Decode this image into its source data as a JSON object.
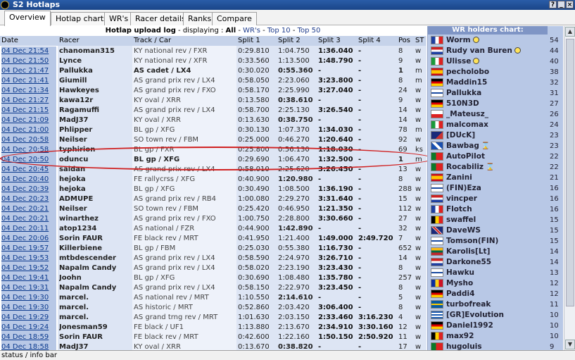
{
  "window": {
    "title": "S2 Hotlaps",
    "buttons": [
      "?",
      "_",
      "×"
    ]
  },
  "tabs": [
    {
      "label": "Overview",
      "active": true
    },
    {
      "label": "Hotlap charts",
      "active": false
    },
    {
      "label": "WR's",
      "active": false
    },
    {
      "label": "Racer details",
      "active": false
    },
    {
      "label": "Ranks",
      "active": false
    },
    {
      "label": "Compare",
      "active": false
    }
  ],
  "log": {
    "heading": "Hotlap upload log",
    "displaying_label": " - displaying : ",
    "filter_all": "All",
    "filter_sep": " - ",
    "filter_wrs": "WR's",
    "filter_top10": "Top 10",
    "filter_top50": "Top 50",
    "columns": [
      "Date",
      "Racer",
      "Track / Car",
      "Split 1",
      "Split 2",
      "Split 3",
      "Split 4",
      "Pos",
      "ST"
    ],
    "rows": [
      {
        "date": "04 Dec 21:54",
        "racer": "chanoman315",
        "track": "KY national rev / FXR",
        "s1": "0:29.810",
        "s2": "1:04.750",
        "s3": "1:36.040",
        "s4": "-",
        "pos": "8",
        "st": "w"
      },
      {
        "date": "04 Dec 21:50",
        "racer": "Lynce",
        "track": "KY national rev / XFR",
        "s1": "0:33.560",
        "s2": "1:13.500",
        "s3": "1:48.790",
        "s4": "-",
        "pos": "9",
        "st": "w"
      },
      {
        "date": "04 Dec 21:47",
        "racer": "Pallukka",
        "track": "AS cadet / LX4",
        "s1": "0:30.020",
        "s2": "0:55.360",
        "s3": "-",
        "s4": "-",
        "pos": "1",
        "st": "m"
      },
      {
        "date": "04 Dec 21:41",
        "racer": "Giumill",
        "track": "AS grand prix rev / LX4",
        "s1": "0:58.050",
        "s2": "2:23.060",
        "s3": "3:23.800",
        "s4": "-",
        "pos": "8",
        "st": "m"
      },
      {
        "date": "04 Dec 21:34",
        "racer": "Hawkeyes",
        "track": "AS grand prix rev / FXO",
        "s1": "0:58.170",
        "s2": "2:25.990",
        "s3": "3:27.040",
        "s4": "-",
        "pos": "24",
        "st": "w"
      },
      {
        "date": "04 Dec 21:27",
        "racer": "kawa12r",
        "track": "KY oval / XRR",
        "s1": "0:13.580",
        "s2": "0:38.610",
        "s3": "-",
        "s4": "-",
        "pos": "9",
        "st": "w"
      },
      {
        "date": "04 Dec 21:15",
        "racer": "Ragamuffi",
        "track": "AS grand prix rev / LX4",
        "s1": "0:58.700",
        "s2": "2:25.130",
        "s3": "3:26.540",
        "s4": "-",
        "pos": "14",
        "st": "w"
      },
      {
        "date": "04 Dec 21:09",
        "racer": "MadJ37",
        "track": "KY oval / XRR",
        "s1": "0:13.630",
        "s2": "0:38.750",
        "s3": "-",
        "s4": "-",
        "pos": "14",
        "st": "w"
      },
      {
        "date": "04 Dec 21:00",
        "racer": "Phlipper",
        "track": "BL gp / XFG",
        "s1": "0:30.130",
        "s2": "1:07.370",
        "s3": "1:34.030",
        "s4": "-",
        "pos": "78",
        "st": "m"
      },
      {
        "date": "04 Dec 20:58",
        "racer": "Neilser",
        "track": "SO town rev / FBM",
        "s1": "0:25.000",
        "s2": "0:46.270",
        "s3": "1:20.640",
        "s4": "-",
        "pos": "92",
        "st": "w"
      },
      {
        "date": "04 Dec 20:58",
        "racer": "typhirion",
        "track": "BL gp / FXR",
        "s1": "0:25.800",
        "s2": "0:56.130",
        "s3": "1:18.030",
        "s4": "-",
        "pos": "69",
        "st": "ks"
      },
      {
        "date": "04 Dec 20:50",
        "racer": "oduncu",
        "track": "BL gp / XFG",
        "s1": "0:29.690",
        "s2": "1:06.470",
        "s3": "1:32.500",
        "s4": "-",
        "pos": "1",
        "st": "m",
        "highlight": true
      },
      {
        "date": "04 Dec 20:45",
        "racer": "saldan",
        "track": "AS grand prix rev / LX4",
        "s1": "0:58.010",
        "s2": "2:25.620",
        "s3": "3:26.450",
        "s4": "-",
        "pos": "13",
        "st": "w"
      },
      {
        "date": "04 Dec 20:40",
        "racer": "hejoka",
        "track": "FE rallycrss / XFG",
        "s1": "0:40.900",
        "s2": "1:20.980",
        "s3": "-",
        "s4": "-",
        "pos": "8",
        "st": "w"
      },
      {
        "date": "04 Dec 20:39",
        "racer": "hejoka",
        "track": "BL gp / XFG",
        "s1": "0:30.490",
        "s2": "1:08.500",
        "s3": "1:36.190",
        "s4": "-",
        "pos": "288",
        "st": "w"
      },
      {
        "date": "04 Dec 20:23",
        "racer": "ADMUPE",
        "track": "AS grand prix rev / RB4",
        "s1": "1:00.080",
        "s2": "2:29.270",
        "s3": "3:31.640",
        "s4": "-",
        "pos": "15",
        "st": "w"
      },
      {
        "date": "04 Dec 20:21",
        "racer": "Neilser",
        "track": "SO town rev / FBM",
        "s1": "0:25.420",
        "s2": "0:46.950",
        "s3": "1:21.350",
        "s4": "-",
        "pos": "112",
        "st": "w"
      },
      {
        "date": "04 Dec 20:21",
        "racer": "winarthez",
        "track": "AS grand prix rev / FXO",
        "s1": "1:00.750",
        "s2": "2:28.800",
        "s3": "3:30.660",
        "s4": "-",
        "pos": "27",
        "st": "w"
      },
      {
        "date": "04 Dec 20:11",
        "racer": "atop1234",
        "track": "AS national / FZR",
        "s1": "0:44.900",
        "s2": "1:42.890",
        "s3": "-",
        "s4": "-",
        "pos": "32",
        "st": "w"
      },
      {
        "date": "04 Dec 20:06",
        "racer": "Sorin FAUR",
        "track": "FE black rev / MRT",
        "s1": "0:41.950",
        "s2": "1:21.400",
        "s3": "1:49.000",
        "s4": "2:49.720",
        "pos": "7",
        "st": "w"
      },
      {
        "date": "04 Dec 19:57",
        "racer": "Killerbiene",
        "track": "BL gp / FBM",
        "s1": "0:25.030",
        "s2": "0:55.380",
        "s3": "1:16.730",
        "s4": "-",
        "pos": "652",
        "st": "w"
      },
      {
        "date": "04 Dec 19:53",
        "racer": "mtbdescender",
        "track": "AS grand prix rev / LX4",
        "s1": "0:58.590",
        "s2": "2:24.970",
        "s3": "3:26.710",
        "s4": "-",
        "pos": "14",
        "st": "w"
      },
      {
        "date": "04 Dec 19:52",
        "racer": "Napalm Candy",
        "track": "AS grand prix rev / LX4",
        "s1": "0:58.020",
        "s2": "2:23.190",
        "s3": "3:23.430",
        "s4": "-",
        "pos": "8",
        "st": "w"
      },
      {
        "date": "04 Dec 19:41",
        "racer": "Joohn",
        "track": "BL gp / XFG",
        "s1": "0:30.690",
        "s2": "1:08.480",
        "s3": "1:35.780",
        "s4": "-",
        "pos": "257",
        "st": "w"
      },
      {
        "date": "04 Dec 19:31",
        "racer": "Napalm Candy",
        "track": "AS grand prix rev / LX4",
        "s1": "0:58.150",
        "s2": "2:22.970",
        "s3": "3:23.450",
        "s4": "-",
        "pos": "8",
        "st": "w"
      },
      {
        "date": "04 Dec 19:30",
        "racer": "marcel.",
        "track": "AS national rev / MRT",
        "s1": "1:10.550",
        "s2": "2:14.610",
        "s3": "-",
        "s4": "-",
        "pos": "5",
        "st": "w"
      },
      {
        "date": "04 Dec 19:30",
        "racer": "marcel.",
        "track": "AS historic / MRT",
        "s1": "0:52.860",
        "s2": "2:03.420",
        "s3": "3:06.400",
        "s4": "-",
        "pos": "8",
        "st": "w"
      },
      {
        "date": "04 Dec 19:29",
        "racer": "marcel.",
        "track": "AS grand trng rev / MRT",
        "s1": "1:01.630",
        "s2": "2:03.150",
        "s3": "2:33.460",
        "s4": "3:16.230",
        "pos": "4",
        "st": "w"
      },
      {
        "date": "04 Dec 19:24",
        "racer": "Jonesman59",
        "track": "FE black / UF1",
        "s1": "1:13.880",
        "s2": "2:13.670",
        "s3": "2:34.910",
        "s4": "3:30.160",
        "pos": "12",
        "st": "w"
      },
      {
        "date": "04 Dec 18:59",
        "racer": "Sorin FAUR",
        "track": "FE black rev / MRT",
        "s1": "0:42.600",
        "s2": "1:22.160",
        "s3": "1:50.150",
        "s4": "2:50.920",
        "pos": "11",
        "st": "w"
      },
      {
        "date": "04 Dec 18:58",
        "racer": "MadJ37",
        "track": "KY oval / XRR",
        "s1": "0:13.670",
        "s2": "0:38.820",
        "s3": "-",
        "s4": "-",
        "pos": "17",
        "st": "w"
      }
    ]
  },
  "wr_chart": {
    "heading": "WR holders chart:",
    "holders": [
      {
        "name": "Worm",
        "count": "54",
        "flag": "fr",
        "badge": "smile"
      },
      {
        "name": "Rudy van Buren",
        "count": "44",
        "flag": "nl",
        "badge": "smile"
      },
      {
        "name": "Ulisse",
        "count": "40",
        "flag": "it",
        "badge": "smile"
      },
      {
        "name": "pecholobo",
        "count": "38",
        "flag": "es",
        "badge": ""
      },
      {
        "name": "Maddin15",
        "count": "32",
        "flag": "de",
        "badge": ""
      },
      {
        "name": "Pallukka",
        "count": "31",
        "flag": "fi",
        "badge": ""
      },
      {
        "name": "510N3D",
        "count": "27",
        "flag": "de",
        "badge": ""
      },
      {
        "name": "_Mateusz_",
        "count": "26",
        "flag": "pl",
        "badge": ""
      },
      {
        "name": "malcomax",
        "count": "24",
        "flag": "it",
        "badge": ""
      },
      {
        "name": "[DUcK]",
        "count": "23",
        "flag": "au",
        "badge": ""
      },
      {
        "name": "Bawbag",
        "count": "23",
        "flag": "sc",
        "badge": "hourglass"
      },
      {
        "name": "AutoPilot",
        "count": "22",
        "flag": "pt",
        "badge": ""
      },
      {
        "name": "Rocabiliz",
        "count": "22",
        "flag": "pt",
        "badge": "hourglass"
      },
      {
        "name": "Zanini",
        "count": "21",
        "flag": "es",
        "badge": ""
      },
      {
        "name": "(FIN)Eza",
        "count": "16",
        "flag": "fi",
        "badge": ""
      },
      {
        "name": "vincper",
        "count": "16",
        "flag": "nl",
        "badge": ""
      },
      {
        "name": "Flotch",
        "count": "16",
        "flag": "fr",
        "badge": ""
      },
      {
        "name": "swaffel",
        "count": "15",
        "flag": "be",
        "badge": ""
      },
      {
        "name": "DaveWS",
        "count": "15",
        "flag": "uk",
        "badge": ""
      },
      {
        "name": "Tomson(FIN)",
        "count": "15",
        "flag": "fi",
        "badge": ""
      },
      {
        "name": "Karolis[Lt]",
        "count": "14",
        "flag": "lt",
        "badge": ""
      },
      {
        "name": "Darkone55",
        "count": "14",
        "flag": "nl",
        "badge": ""
      },
      {
        "name": "Hawku",
        "count": "13",
        "flag": "fi",
        "badge": ""
      },
      {
        "name": "Mysho",
        "count": "12",
        "flag": "ro",
        "badge": ""
      },
      {
        "name": "Paddi4",
        "count": "12",
        "flag": "de",
        "badge": ""
      },
      {
        "name": "turbofreak",
        "count": "11",
        "flag": "se",
        "badge": ""
      },
      {
        "name": "[GR]Evolution",
        "count": "10",
        "flag": "gr",
        "badge": ""
      },
      {
        "name": "Daniel1992",
        "count": "10",
        "flag": "de",
        "badge": ""
      },
      {
        "name": "max92",
        "count": "10",
        "flag": "be",
        "badge": ""
      },
      {
        "name": "hugoluis",
        "count": "9",
        "flag": "pt",
        "badge": ""
      }
    ]
  },
  "status_bar": {
    "text": "status / info bar"
  }
}
